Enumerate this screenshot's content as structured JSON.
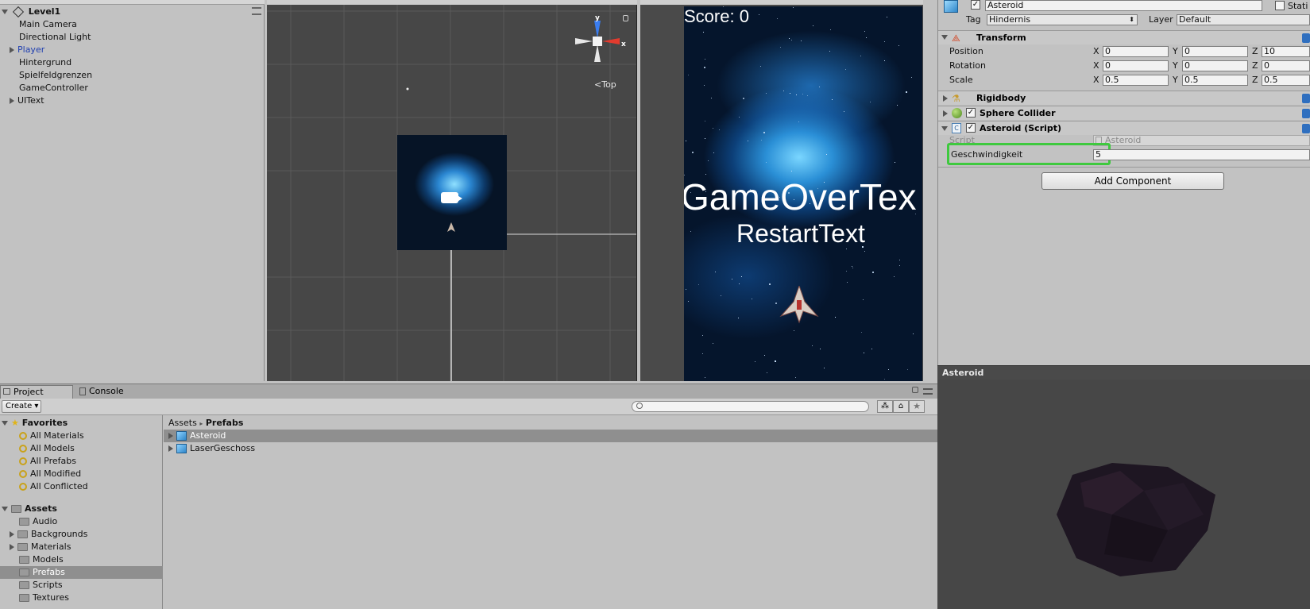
{
  "hierarchy": {
    "scene_name": "Level1",
    "items": [
      {
        "label": "Main Camera"
      },
      {
        "label": "Directional Light"
      },
      {
        "label": "Player"
      },
      {
        "label": "Hintergrund"
      },
      {
        "label": "Spielfeldgrenzen"
      },
      {
        "label": "GameController"
      },
      {
        "label": "UIText"
      }
    ]
  },
  "scene_view": {
    "gizmo_y": "y",
    "gizmo_x": "x",
    "view_label": "Top"
  },
  "game_view": {
    "score_text": "Score: 0",
    "gameover_text": "GameOverTex",
    "restart_text": "RestartText"
  },
  "inspector": {
    "object_name": "Asteroid",
    "static_label": "Stati",
    "tag_label": "Tag",
    "tag_value": "Hindernis",
    "layer_label": "Layer",
    "layer_value": "Default",
    "transform": {
      "title": "Transform",
      "position_label": "Position",
      "rotation_label": "Rotation",
      "scale_label": "Scale",
      "axis_x": "X",
      "axis_y": "Y",
      "axis_z": "Z",
      "position": [
        "0",
        "0",
        "10"
      ],
      "rotation": [
        "0",
        "0",
        "0"
      ],
      "scale": [
        "0.5",
        "0.5",
        "0.5"
      ]
    },
    "rigidbody_title": "Rigidbody",
    "sphere_collider_title": "Sphere Collider",
    "script_component_title": "Asteroid (Script)",
    "script_label": "Script",
    "script_value": "Asteroid",
    "speed_label": "Geschwindigkeit",
    "speed_value": "5",
    "add_component": "Add Component",
    "highlight_color": "#3ec93e"
  },
  "preview": {
    "title": "Asteroid"
  },
  "project": {
    "tab_project": "Project",
    "tab_console": "Console",
    "create_label": "Create",
    "favorites_title": "Favorites",
    "favorites": [
      "All Materials",
      "All Models",
      "All Prefabs",
      "All Modified",
      "All Conflicted"
    ],
    "assets_title": "Assets",
    "folders": [
      "Audio",
      "Backgrounds",
      "Materials",
      "Models",
      "Prefabs",
      "Scripts",
      "Textures"
    ],
    "selected_folder": "Prefabs",
    "breadcrumb_root": "Assets",
    "breadcrumb_current": "Prefabs",
    "files": [
      "Asteroid",
      "LaserGeschoss"
    ]
  }
}
